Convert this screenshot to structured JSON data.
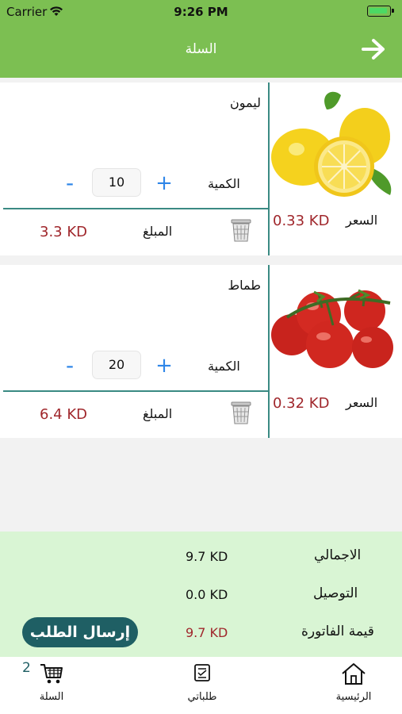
{
  "status": {
    "carrier": "Carrier",
    "time": "9:26 PM"
  },
  "nav": {
    "title": "السلة"
  },
  "items": [
    {
      "name": "ليمون",
      "qty_label": "الكمية",
      "qty": "10",
      "minus": "-",
      "plus": "+",
      "amount_label": "المبلغ",
      "amount": "3.3 KD",
      "price_label": "السعر",
      "price": "0.33 KD",
      "image": "lemon"
    },
    {
      "name": "طماط",
      "qty_label": "الكمية",
      "qty": "20",
      "minus": "-",
      "plus": "+",
      "amount_label": "المبلغ",
      "amount": "6.4 KD",
      "price_label": "السعر",
      "price": "0.32 KD",
      "image": "tomato"
    }
  ],
  "summary": {
    "total_label": "الاجمالي",
    "total": "9.7 KD",
    "delivery_label": "التوصيل",
    "delivery": "0.0 KD",
    "invoice_label": "قيمة الفاتورة",
    "invoice": "9.7 KD",
    "send_button": "إرسال الطلب"
  },
  "tabs": {
    "cart_label": "السلة",
    "cart_badge": "2",
    "orders_label": "طلباتي",
    "home_label": "الرئيسية"
  },
  "colors": {
    "header": "#7cbf52",
    "accent": "#3a8a83",
    "price": "#a0272c",
    "summary_bg": "#d9f5d4",
    "button": "#1f5f64",
    "stepper": "#2f86e8"
  },
  "icons": [
    "wifi-icon",
    "battery-icon",
    "arrow-right-icon",
    "trash-icon",
    "cart-icon",
    "orders-icon",
    "home-icon"
  ]
}
